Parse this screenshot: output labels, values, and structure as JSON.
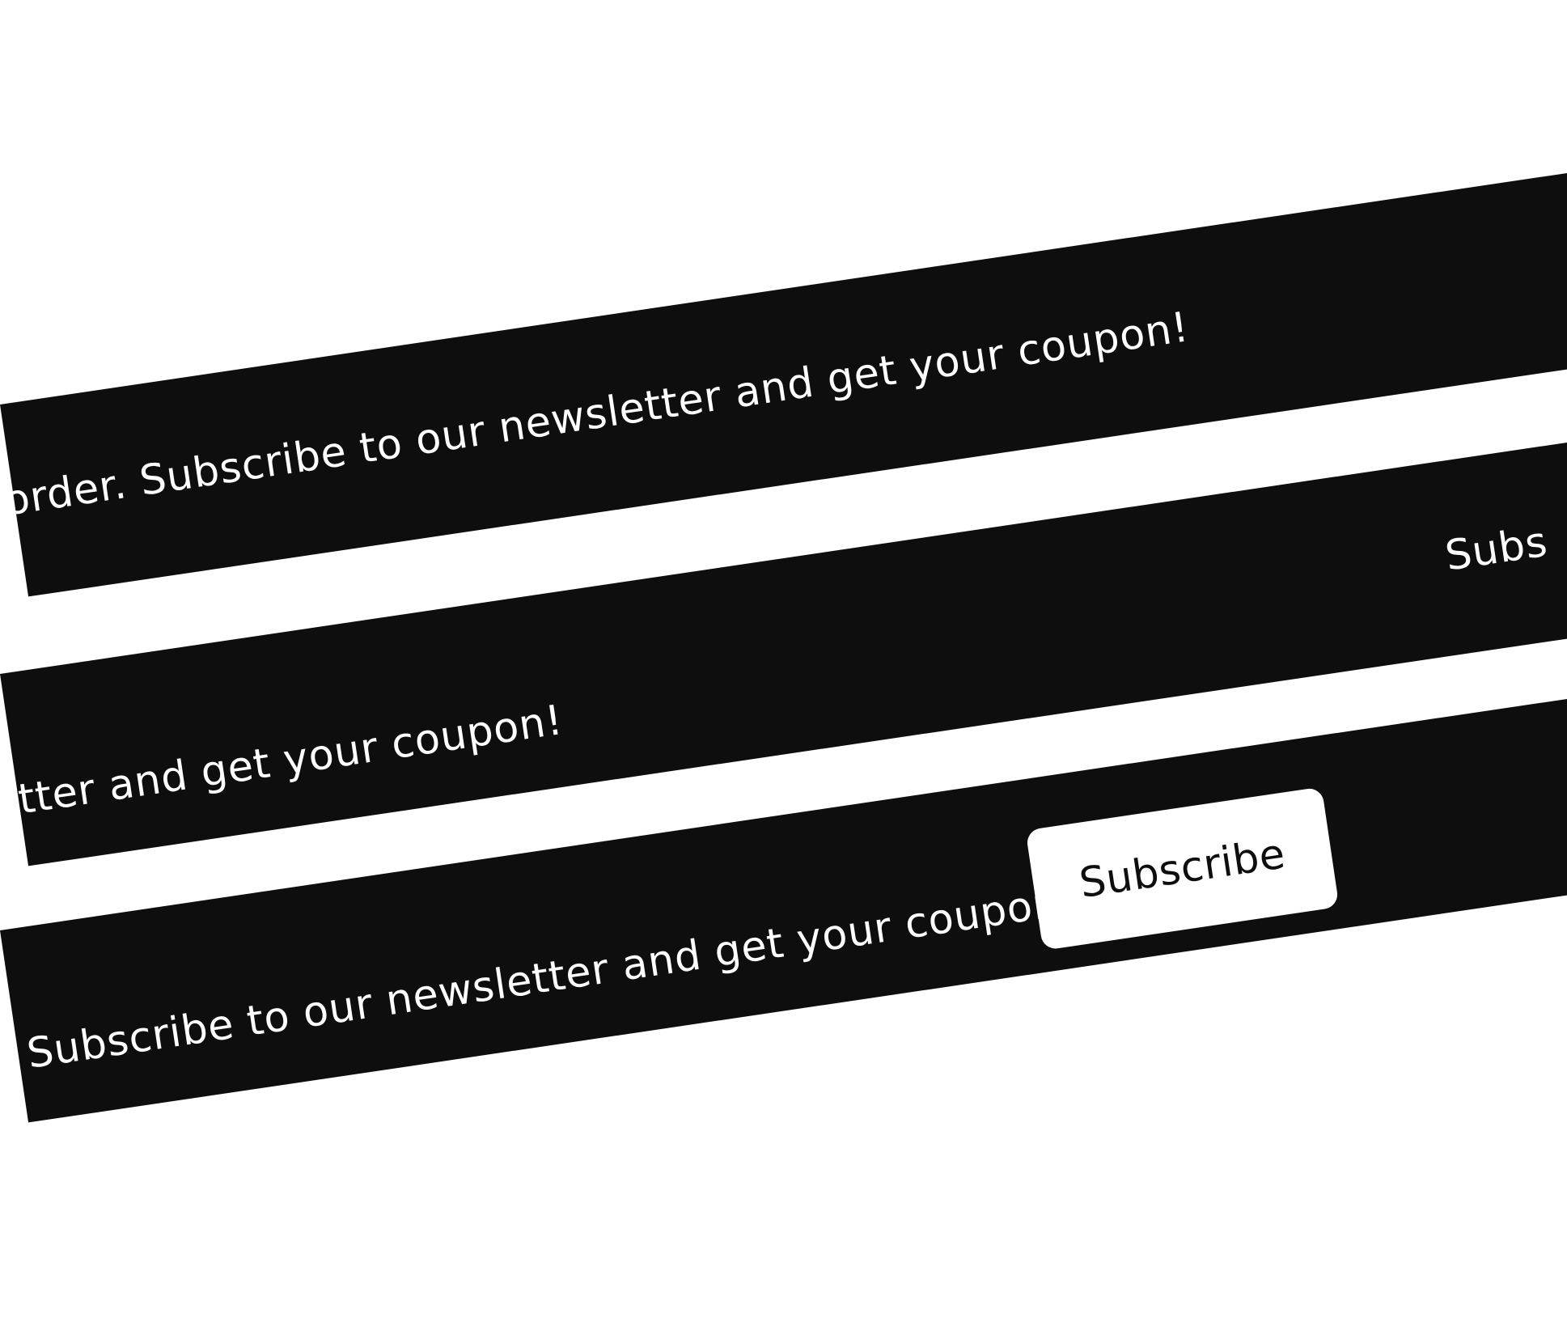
{
  "banners": [
    {
      "message": "order. Subscribe to our newsletter and get your coupon!"
    },
    {
      "message": "etter and get your coupon!",
      "trailing_text": "Subs"
    },
    {
      "message": "r. Subscribe to our newsletter and get your coupon!",
      "button_label": "Subscribe"
    }
  ],
  "colors": {
    "banner_background": "#0e0e0e",
    "banner_text": "#ffffff",
    "page_background": "#ffffff",
    "button_background": "#ffffff",
    "button_text": "#0e0e0e"
  }
}
